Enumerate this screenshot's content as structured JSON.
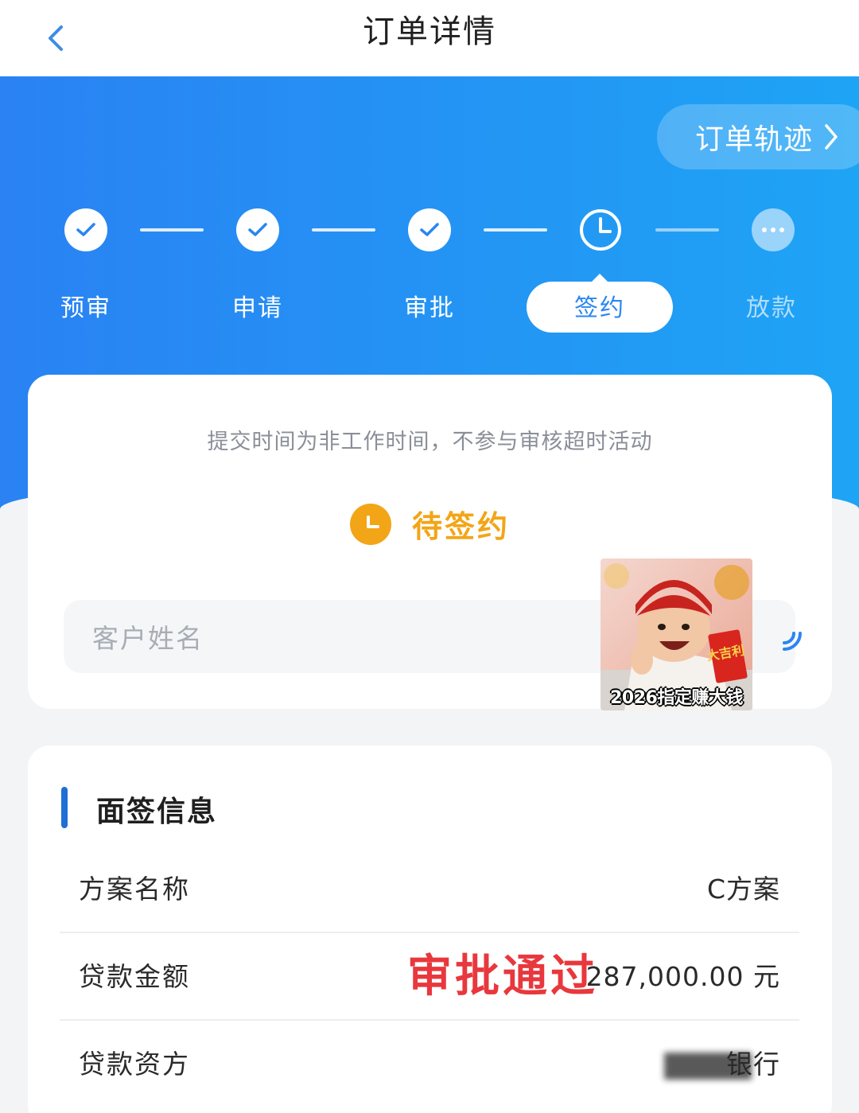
{
  "header": {
    "title": "订单详情"
  },
  "hero": {
    "track_button": "订单轨迹",
    "steps": [
      {
        "label": "预审",
        "state": "done"
      },
      {
        "label": "申请",
        "state": "done"
      },
      {
        "label": "审批",
        "state": "done"
      },
      {
        "label": "签约",
        "state": "current"
      },
      {
        "label": "放款",
        "state": "pending"
      }
    ]
  },
  "status_card": {
    "notice": "提交时间为非工作时间，不参与审核超时活动",
    "status": "待签约",
    "customer_name_placeholder": "客户姓名"
  },
  "sticker": {
    "caption": "2026指定赚大钱",
    "envelope_text": "大吉利"
  },
  "info": {
    "section_title": "面签信息",
    "rows": [
      {
        "label": "方案名称",
        "value": "C方案"
      },
      {
        "label": "贷款金额",
        "value": "287,000.00 元"
      },
      {
        "label": "贷款资方",
        "value": "银行"
      }
    ],
    "stamp": "审批通过"
  },
  "colors": {
    "hero_start": "#2a82f3",
    "hero_end": "#1ea4f5",
    "status_orange": "#f2a516",
    "stamp_red": "#e8383d",
    "accent_blue": "#1f6fd6"
  }
}
